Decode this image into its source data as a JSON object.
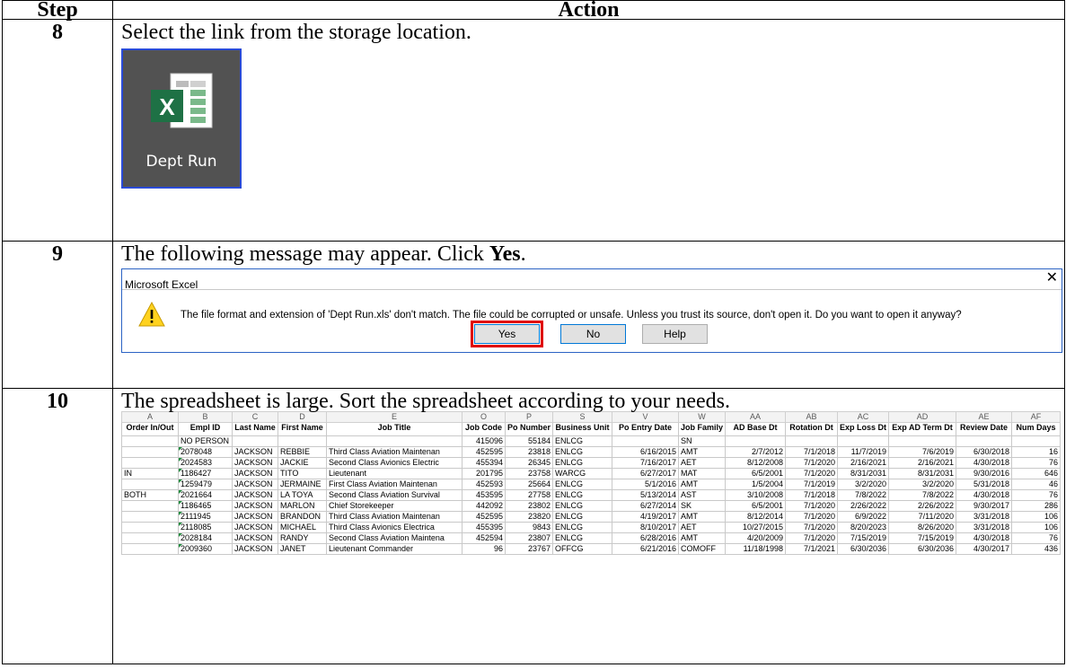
{
  "header": {
    "step": "Step",
    "action": "Action"
  },
  "steps": [
    {
      "number": "8",
      "text": "Select the link from the storage location."
    },
    {
      "number": "9",
      "text_before": "The following message may appear. Click ",
      "text_bold": "Yes",
      "text_after": "."
    },
    {
      "number": "10",
      "text": "The spreadsheet is large. Sort the spreadsheet according to your needs."
    }
  ],
  "shortcut": {
    "label": "Dept Run",
    "icon": "excel-file-icon",
    "colors": {
      "tile_bg": "#525252",
      "border": "#2a4bd7",
      "excel_green": "#1e7145"
    }
  },
  "dialog": {
    "title": "Microsoft Excel",
    "message": "The file format and extension of 'Dept Run.xls' don't match. The file could be corrupted or unsafe. Unless you trust its source, don't open it. Do you want to open it anyway?",
    "buttons": {
      "yes": "Yes",
      "no": "No",
      "help": "Help"
    },
    "icons": {
      "warning": "warning-triangle-icon",
      "close": "close-icon"
    },
    "highlight_color": "#e00000"
  },
  "spreadsheet": {
    "column_letters": [
      "A",
      "B",
      "C",
      "D",
      "E",
      "O",
      "P",
      "S",
      "V",
      "W",
      "AA",
      "AB",
      "AC",
      "AD",
      "AE",
      "AF"
    ],
    "headers": [
      "Order In/Out",
      "Empl ID",
      "Last Name",
      "First Name",
      "Job Title",
      "Job Code",
      "Po Number",
      "Business Unit",
      "Po Entry Date",
      "Job Family",
      "AD Base Dt",
      "Rotation Dt",
      "Exp Loss Dt",
      "Exp AD Term Dt",
      "Review Date",
      "Num Days"
    ],
    "rows": [
      [
        "",
        "NO PERSON",
        "",
        "",
        "",
        "415096",
        "55184",
        "ENLCG",
        "",
        "SN",
        "",
        "",
        "",
        "",
        "",
        ""
      ],
      [
        "",
        "2078048",
        "JACKSON",
        "REBBIE",
        "Third Class Aviation Maintenan",
        "452595",
        "23818",
        "ENLCG",
        "6/16/2015",
        "AMT",
        "2/7/2012",
        "7/1/2018",
        "11/7/2019",
        "7/6/2019",
        "6/30/2018",
        "16"
      ],
      [
        "",
        "2024583",
        "JACKSON",
        "JACKIE",
        "Second Class Avionics Electric",
        "455394",
        "26345",
        "ENLCG",
        "7/16/2017",
        "AET",
        "8/12/2008",
        "7/1/2020",
        "2/16/2021",
        "2/16/2021",
        "4/30/2018",
        "76"
      ],
      [
        "IN",
        "1186427",
        "JACKSON",
        "TITO",
        "Lieutenant",
        "201795",
        "23758",
        "WARCG",
        "6/27/2017",
        "MAT",
        "6/5/2001",
        "7/1/2020",
        "8/31/2031",
        "8/31/2031",
        "9/30/2016",
        "646"
      ],
      [
        "",
        "1259479",
        "JACKSON",
        "JERMAINE",
        "First Class Aviation Maintenan",
        "452593",
        "25664",
        "ENLCG",
        "5/1/2016",
        "AMT",
        "1/5/2004",
        "7/1/2019",
        "3/2/2020",
        "3/2/2020",
        "5/31/2018",
        "46"
      ],
      [
        "BOTH",
        "2021664",
        "JACKSON",
        "LA TOYA",
        "Second Class Aviation Survival",
        "453595",
        "27758",
        "ENLCG",
        "5/13/2014",
        "AST",
        "3/10/2008",
        "7/1/2018",
        "7/8/2022",
        "7/8/2022",
        "4/30/2018",
        "76"
      ],
      [
        "",
        "1186465",
        "JACKSON",
        "MARLON",
        "Chief Storekeeper",
        "442092",
        "23802",
        "ENLCG",
        "6/27/2014",
        "SK",
        "6/5/2001",
        "7/1/2020",
        "2/26/2022",
        "2/26/2022",
        "9/30/2017",
        "286"
      ],
      [
        "",
        "2111945",
        "JACKSON",
        "BRANDON",
        "Third Class Aviation Maintenan",
        "452595",
        "23820",
        "ENLCG",
        "4/19/2017",
        "AMT",
        "8/12/2014",
        "7/1/2020",
        "6/9/2022",
        "7/11/2020",
        "3/31/2018",
        "106"
      ],
      [
        "",
        "2118085",
        "JACKSON",
        "MICHAEL",
        "Third Class Avionics Electrica",
        "455395",
        "9843",
        "ENLCG",
        "8/10/2017",
        "AET",
        "10/27/2015",
        "7/1/2020",
        "8/20/2023",
        "8/26/2020",
        "3/31/2018",
        "106"
      ],
      [
        "",
        "2028184",
        "JACKSON",
        "RANDY",
        "Second Class Aviation Maintena",
        "452594",
        "23807",
        "ENLCG",
        "6/28/2016",
        "AMT",
        "4/20/2009",
        "7/1/2020",
        "7/15/2019",
        "7/15/2019",
        "4/30/2018",
        "76"
      ],
      [
        "",
        "2009360",
        "JACKSON",
        "JANET",
        "Lieutenant Commander",
        "96",
        "23767",
        "OFFCG",
        "6/21/2016",
        "COMOFF",
        "11/18/1998",
        "7/1/2021",
        "6/30/2036",
        "6/30/2036",
        "4/30/2017",
        "436"
      ]
    ]
  }
}
